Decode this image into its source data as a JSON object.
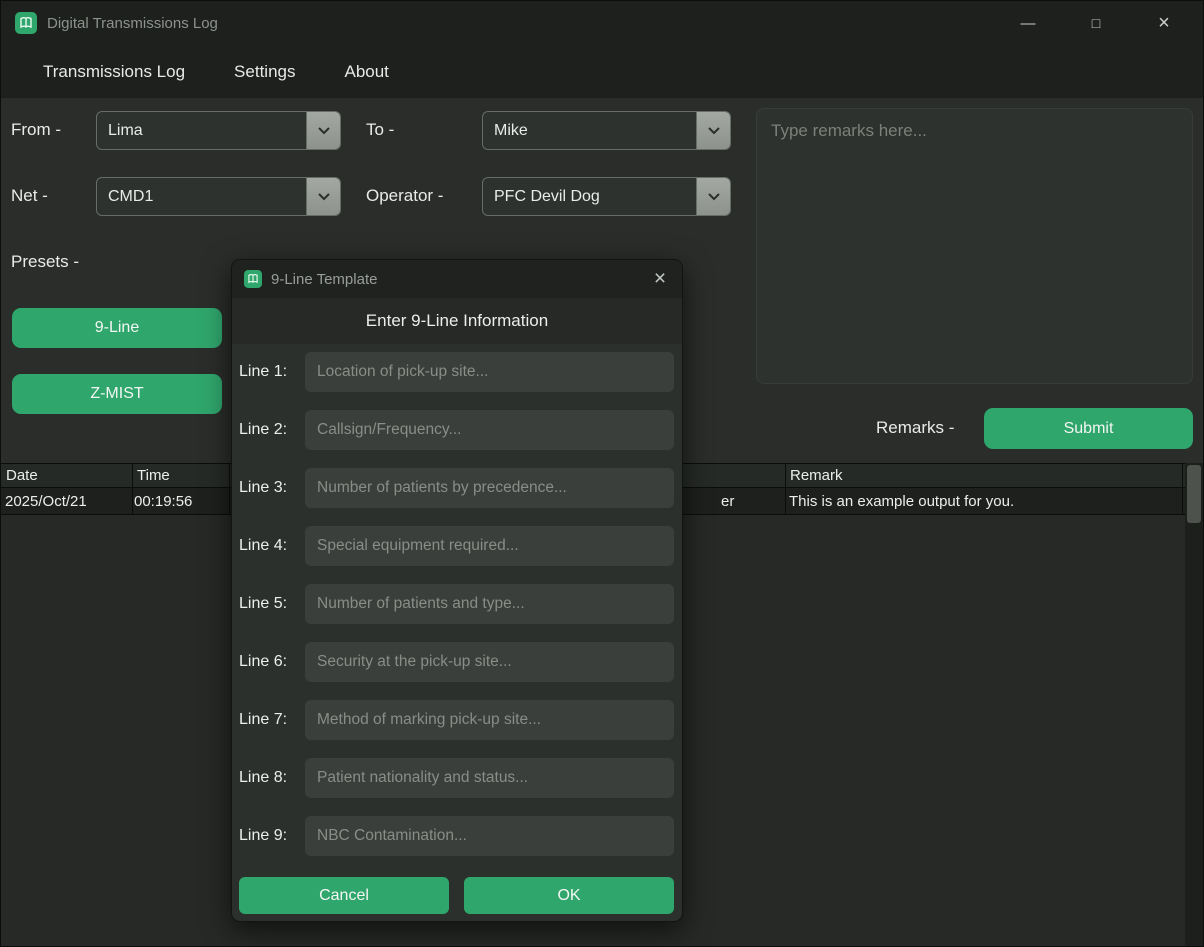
{
  "colors": {
    "accent": "#2FA66C"
  },
  "window": {
    "title": "Digital Transmissions Log",
    "controls": {
      "minimize": "—",
      "maximize": "□",
      "close": "×"
    }
  },
  "menu": {
    "items": [
      {
        "label": "Transmissions Log"
      },
      {
        "label": "Settings"
      },
      {
        "label": "About"
      }
    ]
  },
  "form": {
    "from": {
      "label": "From -",
      "value": "Lima"
    },
    "to": {
      "label": "To -",
      "value": "Mike"
    },
    "net": {
      "label": "Net -",
      "value": "CMD1"
    },
    "operator": {
      "label": "Operator -",
      "value": "PFC Devil Dog"
    },
    "presets_label": "Presets -",
    "preset_buttons": {
      "nine_line": "9-Line",
      "zmist": "Z-MIST"
    },
    "remarks": {
      "placeholder": "Type remarks here...",
      "label": "Remarks -",
      "submit": "Submit"
    }
  },
  "table": {
    "headers": [
      "Date",
      "Time",
      "Remark"
    ],
    "rows": [
      {
        "date": "2025/Oct/21",
        "time": "00:19:56",
        "partial": "er",
        "remark": "This is an example output for you."
      }
    ]
  },
  "dialog": {
    "title": "9-Line Template",
    "close": "×",
    "heading": "Enter 9-Line Information",
    "lines": [
      {
        "label": "Line 1:",
        "placeholder": "Location of pick-up site..."
      },
      {
        "label": "Line 2:",
        "placeholder": "Callsign/Frequency..."
      },
      {
        "label": "Line 3:",
        "placeholder": "Number of patients by precedence..."
      },
      {
        "label": "Line 4:",
        "placeholder": "Special equipment required..."
      },
      {
        "label": "Line 5:",
        "placeholder": "Number of patients and type..."
      },
      {
        "label": "Line 6:",
        "placeholder": "Security at the pick-up site..."
      },
      {
        "label": "Line 7:",
        "placeholder": "Method of marking pick-up site..."
      },
      {
        "label": "Line 8:",
        "placeholder": "Patient nationality and status..."
      },
      {
        "label": "Line 9:",
        "placeholder": "NBC Contamination..."
      }
    ],
    "buttons": {
      "cancel": "Cancel",
      "ok": "OK"
    }
  }
}
